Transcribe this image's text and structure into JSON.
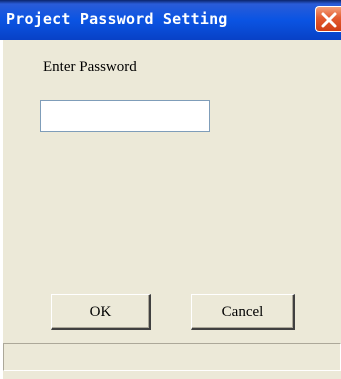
{
  "window": {
    "title": "Project Password Setting"
  },
  "form": {
    "password_label": "Enter Password",
    "password_value": ""
  },
  "buttons": {
    "ok_label": "OK",
    "cancel_label": "Cancel"
  },
  "statusbar": {
    "text": ""
  },
  "icons": {
    "close": "close-icon"
  },
  "colors": {
    "titlebar": "#0a54e3",
    "close_button": "#e35b2f",
    "window_background": "#ece9d8"
  }
}
